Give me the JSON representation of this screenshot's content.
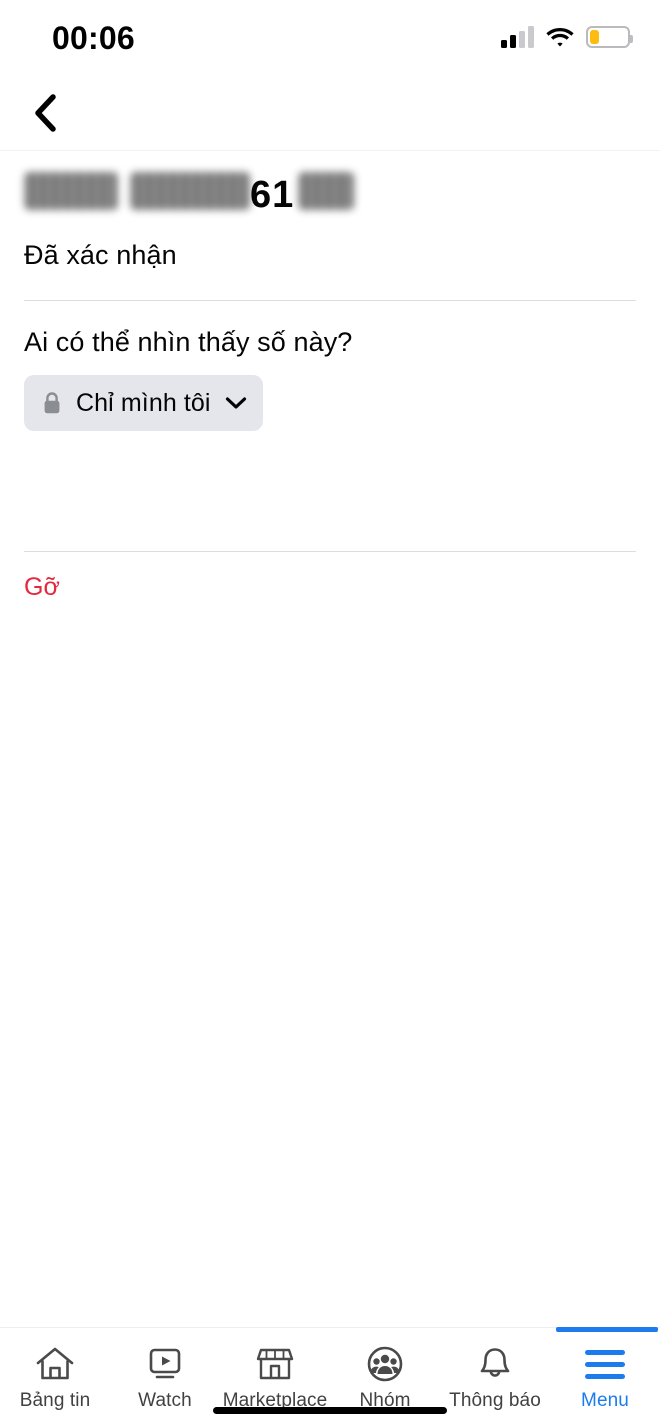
{
  "status_bar": {
    "time": "00:06",
    "signal_icon": "cellular-signal-icon",
    "signal_bars_filled": 2,
    "signal_bars_total": 4,
    "wifi_icon": "wifi-icon",
    "battery_icon": "battery-low-icon",
    "battery_level_percent": 25,
    "battery_color": "#fdbd10"
  },
  "header": {
    "back_icon": "chevron-left-icon"
  },
  "main": {
    "phone_number": {
      "redacted_part_1": "",
      "redacted_part_2": "",
      "visible_digits": "61",
      "redacted_part_3": ""
    },
    "verified_status": "Đã xác nhận",
    "audience_question": "Ai có thể nhìn thấy số này?",
    "audience_selector": {
      "lock_icon": "lock-icon",
      "label": "Chỉ mình tôi",
      "chevron_icon": "chevron-down-icon"
    },
    "remove_label": "Gỡ",
    "remove_color": "#e4293f"
  },
  "tabbar": {
    "accent_color": "#1c7ced",
    "items": [
      {
        "label": "Bảng tin",
        "icon": "home-icon",
        "active": false
      },
      {
        "label": "Watch",
        "icon": "video-play-icon",
        "active": false
      },
      {
        "label": "Marketplace",
        "icon": "storefront-icon",
        "active": false
      },
      {
        "label": "Nhóm",
        "icon": "groups-icon",
        "active": false
      },
      {
        "label": "Thông báo",
        "icon": "bell-icon",
        "active": false
      },
      {
        "label": "Menu",
        "icon": "hamburger-menu-icon",
        "active": true
      }
    ]
  }
}
